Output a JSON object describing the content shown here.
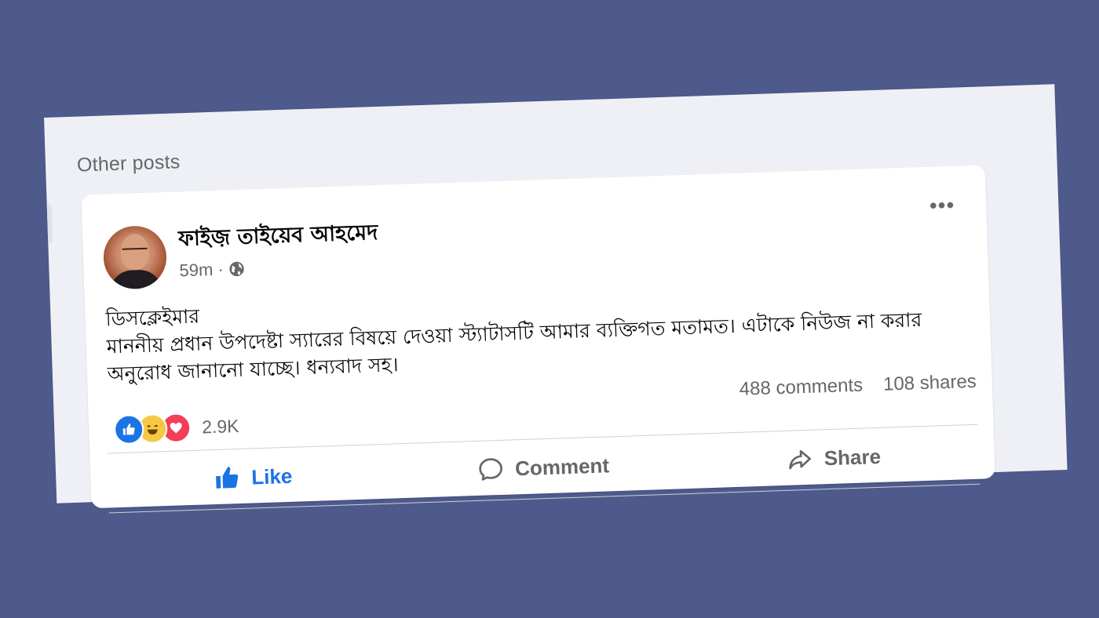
{
  "section": {
    "title": "Other posts"
  },
  "post": {
    "author": "ফাইজ় তাইয়েব আহমেদ",
    "time": "59m",
    "text_line1": "ডিসক্লেইমার",
    "text_line2": "মাননীয় প্রধান উপদেষ্টা স্যারের বিষয়ে দেওয়া স্ট্যাটাসটি আমার ব্যক্তিগত মতামত। এটাকে নিউজ না করার অনুরোধ জানানো যাচ্ছে। ধন্যবাদ সহ।",
    "reaction_count": "2.9K",
    "comments": "488 comments",
    "shares": "108 shares",
    "more_icon": "•••"
  },
  "actions": {
    "like": "Like",
    "comment": "Comment",
    "share": "Share"
  },
  "icons": {
    "like": "thumbs-up-icon",
    "haha": "haha-reaction-icon",
    "love": "heart-reaction-icon",
    "globe": "globe-icon",
    "comment": "speech-bubble-icon",
    "share": "share-arrow-icon"
  },
  "colors": {
    "background": "#4f5a8c",
    "page": "#eef0f5",
    "accent": "#1b74e4",
    "muted": "#65676b"
  }
}
